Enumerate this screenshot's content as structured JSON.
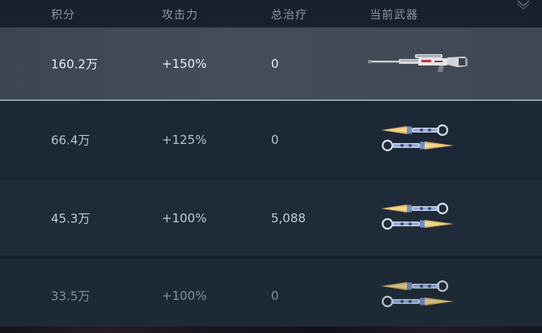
{
  "headers": {
    "score": "积分",
    "attack": "攻击力",
    "heal": "总治疗",
    "weapon": "当前武器"
  },
  "rows": [
    {
      "score": "160.2万",
      "attack": "+150%",
      "heal": "0",
      "weapon_icon": "sniper-rifle-icon",
      "highlighted": true
    },
    {
      "score": "66.4万",
      "attack": "+125%",
      "heal": "0",
      "weapon_icon": "dual-knives-icon",
      "highlighted": false
    },
    {
      "score": "45.3万",
      "attack": "+100%",
      "heal": "5,088",
      "weapon_icon": "dual-knives-icon",
      "highlighted": false
    },
    {
      "score": "33.5万",
      "attack": "+100%",
      "heal": "0",
      "weapon_icon": "dual-knives-icon",
      "highlighted": false
    }
  ],
  "colors": {
    "header_text": "#8d98a6",
    "highlight_row": "#434e5a",
    "row_background": "#1d2836",
    "knife_gold": "#d8b15a",
    "knife_blue": "#6f8fc8"
  }
}
